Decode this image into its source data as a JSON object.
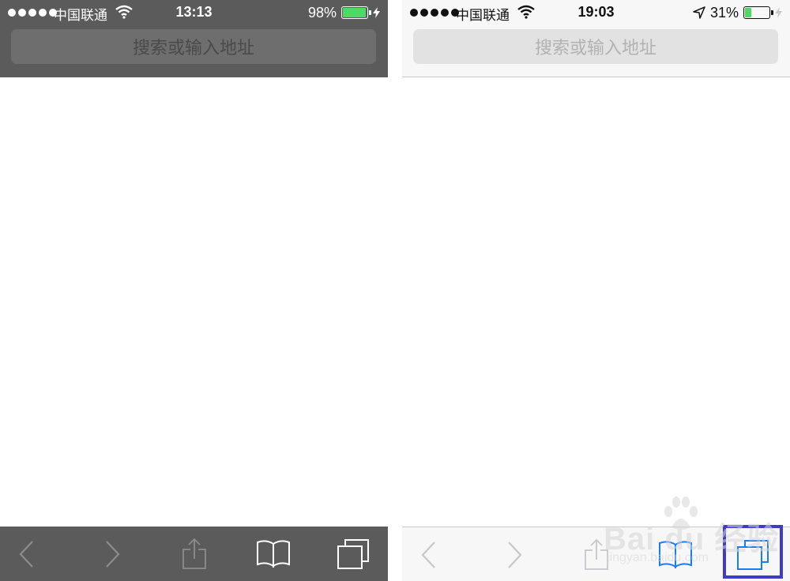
{
  "left_phone": {
    "status": {
      "carrier": "中国联通",
      "time": "13:13",
      "battery_pct": "98%",
      "battery_level": 0.98,
      "battery_color": "#4cd964"
    },
    "address_bar": {
      "placeholder": "搜索或输入地址"
    },
    "toolbar": {
      "icon_color": "#ffffff",
      "icons": [
        "back-icon",
        "forward-icon",
        "share-icon",
        "bookmarks-icon",
        "tabs-icon"
      ]
    }
  },
  "right_phone": {
    "status": {
      "carrier": "中国联通",
      "time": "19:03",
      "battery_pct": "31%",
      "battery_level": 0.31,
      "battery_color": "#4cd964"
    },
    "address_bar": {
      "placeholder": "搜索或输入地址"
    },
    "toolbar": {
      "icon_color": "#c7c7cc",
      "active_color": "#1a7cf5",
      "icons": [
        "back-icon",
        "forward-icon",
        "share-icon",
        "bookmarks-icon",
        "tabs-icon"
      ]
    }
  },
  "watermark": {
    "brand": "Bai du 经验",
    "url": "jingyan.baidu.com"
  }
}
